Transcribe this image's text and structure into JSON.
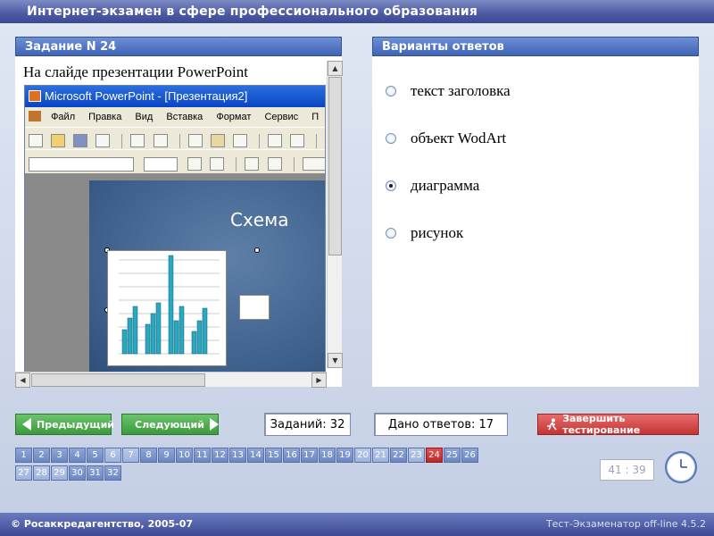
{
  "app_title": "Интернет-экзамен в сфере профессионального образования",
  "question": {
    "header": "Задание N 24",
    "text": "На слайде презентации PowerPoint",
    "embedded": {
      "window_title": "Microsoft PowerPoint - [Презентация2]",
      "menu": [
        "Файл",
        "Правка",
        "Вид",
        "Вставка",
        "Формат",
        "Сервис",
        "П"
      ],
      "slide_title": "Схема"
    }
  },
  "answers": {
    "header": "Варианты ответов",
    "options": [
      {
        "label": "текст заголовка",
        "selected": false
      },
      {
        "label": "объект WodArt",
        "selected": false
      },
      {
        "label": "диаграмма",
        "selected": true
      },
      {
        "label": "рисунок",
        "selected": false
      }
    ]
  },
  "nav": {
    "prev_label": "Предыдущий",
    "next_label": "Следующий",
    "total_label": "Заданий: 32",
    "answered_label": "Дано ответов: 17",
    "finish_label": "Завершить тестирование"
  },
  "question_numbers": [
    {
      "n": "1",
      "state": "normal"
    },
    {
      "n": "2",
      "state": "normal"
    },
    {
      "n": "3",
      "state": "normal"
    },
    {
      "n": "4",
      "state": "normal"
    },
    {
      "n": "5",
      "state": "normal"
    },
    {
      "n": "6",
      "state": "answered"
    },
    {
      "n": "7",
      "state": "answered"
    },
    {
      "n": "8",
      "state": "normal"
    },
    {
      "n": "9",
      "state": "normal"
    },
    {
      "n": "10",
      "state": "normal"
    },
    {
      "n": "11",
      "state": "normal"
    },
    {
      "n": "12",
      "state": "normal"
    },
    {
      "n": "13",
      "state": "normal"
    },
    {
      "n": "14",
      "state": "normal"
    },
    {
      "n": "15",
      "state": "normal"
    },
    {
      "n": "16",
      "state": "normal"
    },
    {
      "n": "17",
      "state": "normal"
    },
    {
      "n": "18",
      "state": "normal"
    },
    {
      "n": "19",
      "state": "normal"
    },
    {
      "n": "20",
      "state": "answered"
    },
    {
      "n": "21",
      "state": "answered"
    },
    {
      "n": "22",
      "state": "normal"
    },
    {
      "n": "23",
      "state": "answered"
    },
    {
      "n": "24",
      "state": "current"
    },
    {
      "n": "25",
      "state": "normal"
    },
    {
      "n": "26",
      "state": "normal"
    },
    {
      "n": "27",
      "state": "answered"
    },
    {
      "n": "28",
      "state": "answered"
    },
    {
      "n": "29",
      "state": "answered"
    },
    {
      "n": "30",
      "state": "normal"
    },
    {
      "n": "31",
      "state": "normal"
    },
    {
      "n": "32",
      "state": "normal"
    }
  ],
  "timer": "41 : 39",
  "footer": {
    "left": "© Росаккредагентство, 2005-07",
    "right": "Тест-Экзаменатор off-line 4.5.2"
  },
  "colors": {
    "title_bar": "#4b5aa3",
    "panel_header": "#4f71c2",
    "nav_button": "#4caf50",
    "finish_button": "#d04040",
    "current_question": "#c83030"
  }
}
